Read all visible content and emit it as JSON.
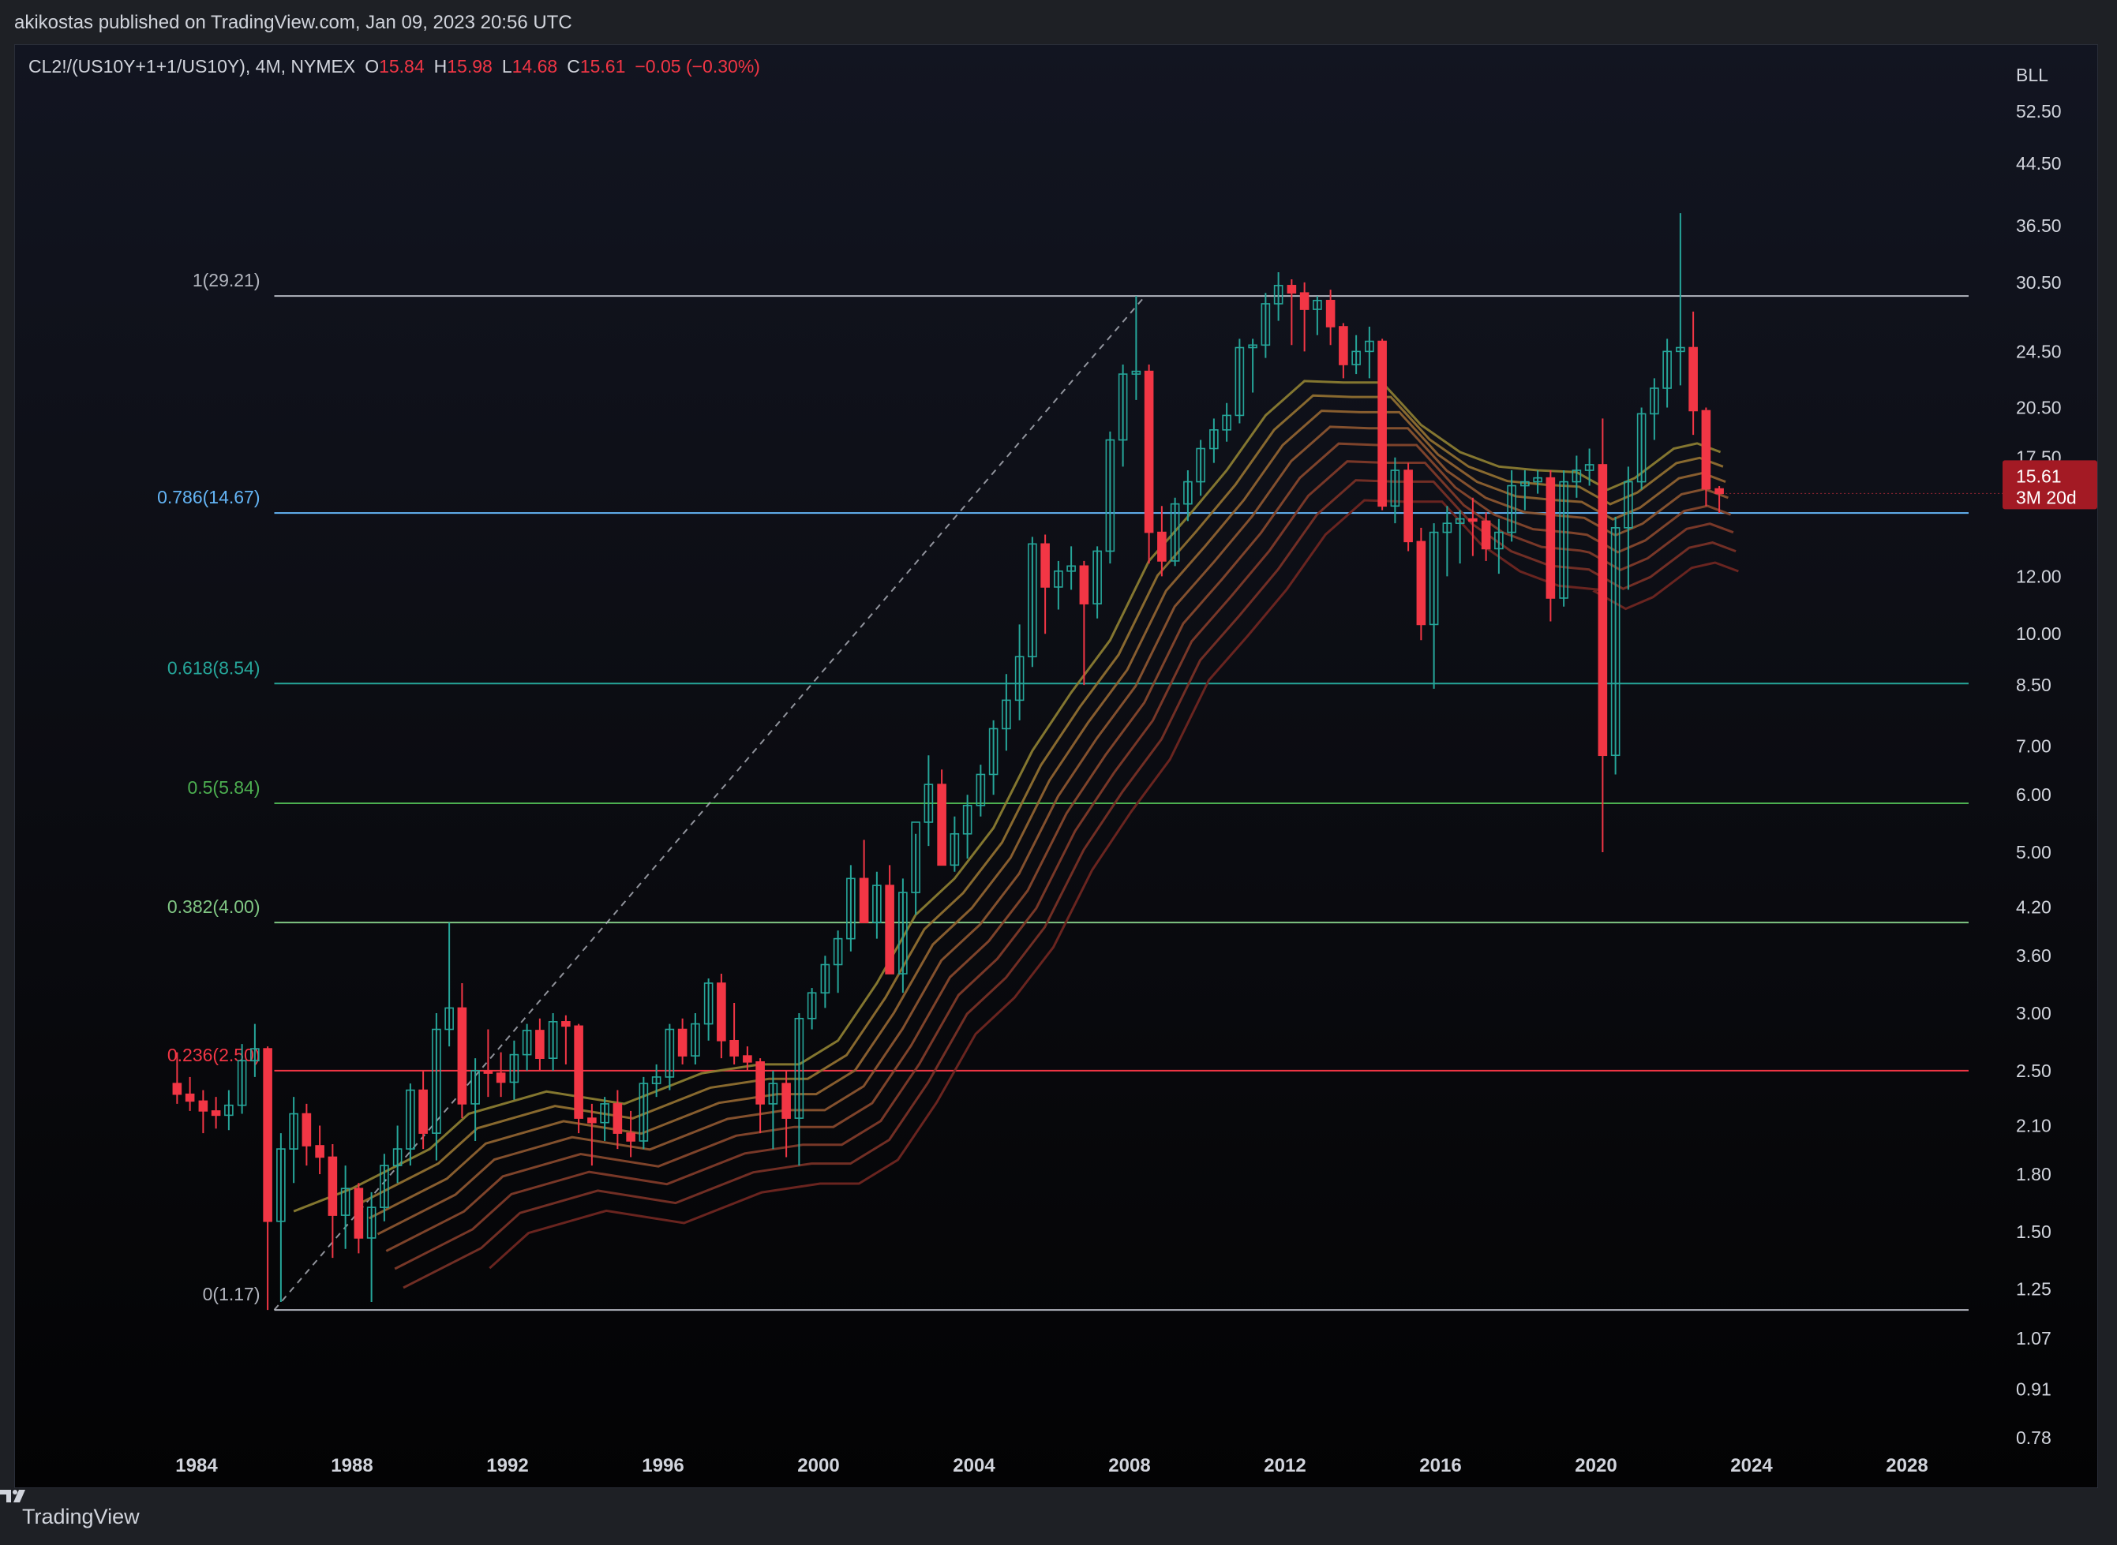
{
  "header": {
    "published": "akikostas published on TradingView.com, Jan 09, 2023 20:56 UTC"
  },
  "legend": {
    "symbol": "CL2!/(US10Y+1+1/US10Y), 4M, NYMEX",
    "o_label": "O",
    "o": "15.84",
    "h_label": "H",
    "h": "15.98",
    "l_label": "L",
    "l": "14.68",
    "c_label": "C",
    "c": "15.61",
    "change": "−0.05 (−0.30%)"
  },
  "footer": {
    "brand": "TradingView"
  },
  "colors": {
    "up": "#26a69a",
    "down": "#f23645",
    "background": "#0b0c11",
    "fib_1": "#b2b5be",
    "fib_0786": "#64b5f6",
    "fib_0618": "#26a69a",
    "fib_05": "#4caf50",
    "fib_0382": "#81c784",
    "fib_0236": "#f23645",
    "fib_0": "#b2b5be"
  },
  "chart_data": {
    "type": "candlestick",
    "scale": "log",
    "y_axis_label": "BLL",
    "y_ticks": [
      52.5,
      44.5,
      36.5,
      30.5,
      24.5,
      20.5,
      17.5,
      12.0,
      10.0,
      8.5,
      7.0,
      6.0,
      5.0,
      4.2,
      3.6,
      3.0,
      2.5,
      2.1,
      1.8,
      1.5,
      1.25,
      1.07,
      0.91,
      0.78
    ],
    "y_tick_labels": [
      "52.50",
      "44.50",
      "36.50",
      "30.50",
      "24.50",
      "20.50",
      "17.50",
      "12.00",
      "10.00",
      "8.50",
      "7.00",
      "6.00",
      "5.00",
      "4.20",
      "3.60",
      "3.00",
      "2.50",
      "2.10",
      "1.80",
      "1.50",
      "1.25",
      "1.07",
      "0.91",
      "0.78"
    ],
    "x_ticks": [
      "1984",
      "1988",
      "1992",
      "1996",
      "2000",
      "2004",
      "2008",
      "2012",
      "2016",
      "2020",
      "2024",
      "2028"
    ],
    "last_price": {
      "value": "15.61",
      "countdown": "3M 20d"
    },
    "fib_levels": [
      {
        "label": "1(29.21)",
        "value": 29.21,
        "color": "#b2b5be"
      },
      {
        "label": "0.786(14.67)",
        "value": 14.67,
        "color": "#64b5f6"
      },
      {
        "label": "0.618(8.54)",
        "value": 8.54,
        "color": "#26a69a"
      },
      {
        "label": "0.5(5.84)",
        "value": 5.84,
        "color": "#4caf50"
      },
      {
        "label": "0.382(4.00)",
        "value": 4.0,
        "color": "#81c784"
      },
      {
        "label": "0.236(2.50)",
        "value": 2.5,
        "color": "#f23645"
      },
      {
        "label": "0(1.17)",
        "value": 1.17,
        "color": "#b2b5be"
      }
    ],
    "fib_anchor": {
      "start": {
        "t": 1986.0,
        "v": 1.17
      },
      "end": {
        "t": 2008.4,
        "v": 29.21
      }
    },
    "candles": [
      {
        "t": 1983.5,
        "o": 2.4,
        "h": 2.65,
        "l": 2.25,
        "c": 2.32
      },
      {
        "t": 1983.83,
        "o": 2.32,
        "h": 2.45,
        "l": 2.2,
        "c": 2.27
      },
      {
        "t": 1984.17,
        "o": 2.27,
        "h": 2.35,
        "l": 2.05,
        "c": 2.2
      },
      {
        "t": 1984.5,
        "o": 2.2,
        "h": 2.3,
        "l": 2.08,
        "c": 2.17
      },
      {
        "t": 1984.83,
        "o": 2.17,
        "h": 2.35,
        "l": 2.07,
        "c": 2.24
      },
      {
        "t": 1985.17,
        "o": 2.24,
        "h": 2.72,
        "l": 2.18,
        "c": 2.58
      },
      {
        "t": 1985.5,
        "o": 2.58,
        "h": 2.9,
        "l": 2.45,
        "c": 2.68
      },
      {
        "t": 1985.83,
        "o": 2.68,
        "h": 2.7,
        "l": 1.17,
        "c": 1.55
      },
      {
        "t": 1986.17,
        "o": 1.55,
        "h": 2.05,
        "l": 1.2,
        "c": 1.95
      },
      {
        "t": 1986.5,
        "o": 1.95,
        "h": 2.3,
        "l": 1.75,
        "c": 2.18
      },
      {
        "t": 1986.83,
        "o": 2.18,
        "h": 2.25,
        "l": 1.85,
        "c": 1.97
      },
      {
        "t": 1987.17,
        "o": 1.97,
        "h": 2.1,
        "l": 1.8,
        "c": 1.9
      },
      {
        "t": 1987.5,
        "o": 1.9,
        "h": 1.98,
        "l": 1.38,
        "c": 1.58
      },
      {
        "t": 1987.83,
        "o": 1.58,
        "h": 1.85,
        "l": 1.42,
        "c": 1.72
      },
      {
        "t": 1988.17,
        "o": 1.72,
        "h": 1.75,
        "l": 1.4,
        "c": 1.47
      },
      {
        "t": 1988.5,
        "o": 1.47,
        "h": 1.7,
        "l": 1.2,
        "c": 1.62
      },
      {
        "t": 1988.83,
        "o": 1.62,
        "h": 1.92,
        "l": 1.55,
        "c": 1.85
      },
      {
        "t": 1989.17,
        "o": 1.85,
        "h": 2.1,
        "l": 1.75,
        "c": 1.95
      },
      {
        "t": 1989.5,
        "o": 1.95,
        "h": 2.4,
        "l": 1.85,
        "c": 2.35
      },
      {
        "t": 1989.83,
        "o": 2.35,
        "h": 2.5,
        "l": 1.95,
        "c": 2.05
      },
      {
        "t": 1990.17,
        "o": 2.05,
        "h": 3.0,
        "l": 1.88,
        "c": 2.85
      },
      {
        "t": 1990.5,
        "o": 2.85,
        "h": 4.0,
        "l": 2.7,
        "c": 3.05
      },
      {
        "t": 1990.83,
        "o": 3.05,
        "h": 3.3,
        "l": 2.15,
        "c": 2.25
      },
      {
        "t": 1991.17,
        "o": 2.25,
        "h": 2.6,
        "l": 2.0,
        "c": 2.5
      },
      {
        "t": 1991.5,
        "o": 2.5,
        "h": 2.85,
        "l": 2.3,
        "c": 2.48
      },
      {
        "t": 1991.83,
        "o": 2.48,
        "h": 2.65,
        "l": 2.3,
        "c": 2.41
      },
      {
        "t": 1992.17,
        "o": 2.41,
        "h": 2.75,
        "l": 2.28,
        "c": 2.63
      },
      {
        "t": 1992.5,
        "o": 2.63,
        "h": 2.9,
        "l": 2.5,
        "c": 2.84
      },
      {
        "t": 1992.83,
        "o": 2.84,
        "h": 2.95,
        "l": 2.5,
        "c": 2.6
      },
      {
        "t": 1993.17,
        "o": 2.6,
        "h": 3.0,
        "l": 2.5,
        "c": 2.92
      },
      {
        "t": 1993.5,
        "o": 2.92,
        "h": 2.98,
        "l": 2.55,
        "c": 2.88
      },
      {
        "t": 1993.83,
        "o": 2.88,
        "h": 2.9,
        "l": 2.05,
        "c": 2.15
      },
      {
        "t": 1994.17,
        "o": 2.15,
        "h": 2.25,
        "l": 1.85,
        "c": 2.12
      },
      {
        "t": 1994.5,
        "o": 2.12,
        "h": 2.3,
        "l": 2.0,
        "c": 2.25
      },
      {
        "t": 1994.83,
        "o": 2.25,
        "h": 2.35,
        "l": 1.95,
        "c": 2.05
      },
      {
        "t": 1995.17,
        "o": 2.05,
        "h": 2.2,
        "l": 1.9,
        "c": 2.0
      },
      {
        "t": 1995.5,
        "o": 2.0,
        "h": 2.45,
        "l": 1.95,
        "c": 2.4
      },
      {
        "t": 1995.83,
        "o": 2.4,
        "h": 2.55,
        "l": 2.3,
        "c": 2.45
      },
      {
        "t": 1996.17,
        "o": 2.45,
        "h": 2.9,
        "l": 2.35,
        "c": 2.85
      },
      {
        "t": 1996.5,
        "o": 2.85,
        "h": 2.95,
        "l": 2.55,
        "c": 2.62
      },
      {
        "t": 1996.83,
        "o": 2.62,
        "h": 3.0,
        "l": 2.55,
        "c": 2.9
      },
      {
        "t": 1997.17,
        "o": 2.9,
        "h": 3.35,
        "l": 2.75,
        "c": 3.3
      },
      {
        "t": 1997.5,
        "o": 3.3,
        "h": 3.4,
        "l": 2.6,
        "c": 2.75
      },
      {
        "t": 1997.83,
        "o": 2.75,
        "h": 3.1,
        "l": 2.55,
        "c": 2.62
      },
      {
        "t": 1998.17,
        "o": 2.62,
        "h": 2.7,
        "l": 2.5,
        "c": 2.57
      },
      {
        "t": 1998.5,
        "o": 2.57,
        "h": 2.6,
        "l": 2.05,
        "c": 2.25
      },
      {
        "t": 1998.83,
        "o": 2.25,
        "h": 2.5,
        "l": 1.95,
        "c": 2.4
      },
      {
        "t": 1999.17,
        "o": 2.4,
        "h": 2.5,
        "l": 1.9,
        "c": 2.15
      },
      {
        "t": 1999.5,
        "o": 2.15,
        "h": 3.0,
        "l": 1.85,
        "c": 2.95
      },
      {
        "t": 1999.83,
        "o": 2.95,
        "h": 3.25,
        "l": 2.85,
        "c": 3.2
      },
      {
        "t": 2000.17,
        "o": 3.2,
        "h": 3.6,
        "l": 3.05,
        "c": 3.5
      },
      {
        "t": 2000.5,
        "o": 3.5,
        "h": 3.9,
        "l": 3.2,
        "c": 3.8
      },
      {
        "t": 2000.83,
        "o": 3.8,
        "h": 4.8,
        "l": 3.65,
        "c": 4.6
      },
      {
        "t": 2001.17,
        "o": 4.6,
        "h": 5.2,
        "l": 4.3,
        "c": 4.0
      },
      {
        "t": 2001.5,
        "o": 4.0,
        "h": 4.7,
        "l": 3.8,
        "c": 4.5
      },
      {
        "t": 2001.83,
        "o": 4.5,
        "h": 4.8,
        "l": 3.4,
        "c": 3.4
      },
      {
        "t": 2002.17,
        "o": 3.4,
        "h": 4.6,
        "l": 3.2,
        "c": 4.4
      },
      {
        "t": 2002.5,
        "o": 4.4,
        "h": 5.3,
        "l": 4.1,
        "c": 5.5
      },
      {
        "t": 2002.83,
        "o": 5.5,
        "h": 6.8,
        "l": 5.1,
        "c": 6.2
      },
      {
        "t": 2003.17,
        "o": 6.2,
        "h": 6.5,
        "l": 4.8,
        "c": 4.8
      },
      {
        "t": 2003.5,
        "o": 4.8,
        "h": 5.6,
        "l": 4.7,
        "c": 5.3
      },
      {
        "t": 2003.83,
        "o": 5.3,
        "h": 6.0,
        "l": 4.9,
        "c": 5.8
      },
      {
        "t": 2004.17,
        "o": 5.8,
        "h": 6.6,
        "l": 5.6,
        "c": 6.4
      },
      {
        "t": 2004.5,
        "o": 6.4,
        "h": 7.6,
        "l": 6.0,
        "c": 7.4
      },
      {
        "t": 2004.83,
        "o": 7.4,
        "h": 8.8,
        "l": 6.9,
        "c": 8.1
      },
      {
        "t": 2005.17,
        "o": 8.1,
        "h": 10.3,
        "l": 7.6,
        "c": 9.3
      },
      {
        "t": 2005.5,
        "o": 9.3,
        "h": 13.6,
        "l": 9.0,
        "c": 13.3
      },
      {
        "t": 2005.83,
        "o": 13.3,
        "h": 13.7,
        "l": 10.0,
        "c": 11.6
      },
      {
        "t": 2006.17,
        "o": 11.6,
        "h": 12.6,
        "l": 10.8,
        "c": 12.2
      },
      {
        "t": 2006.5,
        "o": 12.2,
        "h": 13.2,
        "l": 11.5,
        "c": 12.4
      },
      {
        "t": 2006.83,
        "o": 12.4,
        "h": 12.6,
        "l": 8.5,
        "c": 11.0
      },
      {
        "t": 2007.17,
        "o": 11.0,
        "h": 13.2,
        "l": 10.5,
        "c": 13.0
      },
      {
        "t": 2007.5,
        "o": 13.0,
        "h": 19.0,
        "l": 12.5,
        "c": 18.5
      },
      {
        "t": 2007.83,
        "o": 18.5,
        "h": 23.5,
        "l": 17.0,
        "c": 22.8
      },
      {
        "t": 2008.17,
        "o": 22.8,
        "h": 29.21,
        "l": 21.0,
        "c": 23.0
      },
      {
        "t": 2008.5,
        "o": 23.0,
        "h": 23.5,
        "l": 12.5,
        "c": 13.8
      },
      {
        "t": 2008.83,
        "o": 13.8,
        "h": 15.0,
        "l": 12.0,
        "c": 12.6
      },
      {
        "t": 2009.17,
        "o": 12.6,
        "h": 15.4,
        "l": 12.4,
        "c": 15.1
      },
      {
        "t": 2009.5,
        "o": 15.1,
        "h": 16.8,
        "l": 14.3,
        "c": 16.2
      },
      {
        "t": 2009.83,
        "o": 16.2,
        "h": 18.5,
        "l": 15.5,
        "c": 18.0
      },
      {
        "t": 2010.17,
        "o": 18.0,
        "h": 19.8,
        "l": 17.2,
        "c": 19.1
      },
      {
        "t": 2010.5,
        "o": 19.1,
        "h": 20.8,
        "l": 18.4,
        "c": 20.0
      },
      {
        "t": 2010.83,
        "o": 20.0,
        "h": 25.5,
        "l": 19.5,
        "c": 24.8
      },
      {
        "t": 2011.17,
        "o": 24.8,
        "h": 25.5,
        "l": 21.5,
        "c": 25.0
      },
      {
        "t": 2011.5,
        "o": 25.0,
        "h": 29.5,
        "l": 24.0,
        "c": 28.5
      },
      {
        "t": 2011.83,
        "o": 28.5,
        "h": 31.5,
        "l": 27.0,
        "c": 30.2
      },
      {
        "t": 2012.17,
        "o": 30.2,
        "h": 30.8,
        "l": 25.0,
        "c": 29.5
      },
      {
        "t": 2012.5,
        "o": 29.5,
        "h": 30.5,
        "l": 24.5,
        "c": 28.0
      },
      {
        "t": 2012.83,
        "o": 28.0,
        "h": 29.2,
        "l": 25.8,
        "c": 28.8
      },
      {
        "t": 2013.17,
        "o": 28.8,
        "h": 29.8,
        "l": 25.0,
        "c": 26.5
      },
      {
        "t": 2013.5,
        "o": 26.5,
        "h": 26.8,
        "l": 22.5,
        "c": 23.5
      },
      {
        "t": 2013.83,
        "o": 23.5,
        "h": 25.8,
        "l": 22.8,
        "c": 24.5
      },
      {
        "t": 2014.17,
        "o": 24.5,
        "h": 26.5,
        "l": 22.5,
        "c": 25.3
      },
      {
        "t": 2014.5,
        "o": 25.3,
        "h": 25.5,
        "l": 14.8,
        "c": 15.0
      },
      {
        "t": 2014.83,
        "o": 15.0,
        "h": 17.5,
        "l": 14.2,
        "c": 16.8
      },
      {
        "t": 2015.17,
        "o": 16.8,
        "h": 17.2,
        "l": 13.0,
        "c": 13.4
      },
      {
        "t": 2015.5,
        "o": 13.4,
        "h": 14.0,
        "l": 9.8,
        "c": 10.3
      },
      {
        "t": 2015.83,
        "o": 10.3,
        "h": 14.2,
        "l": 8.4,
        "c": 13.8
      },
      {
        "t": 2016.17,
        "o": 13.8,
        "h": 15.0,
        "l": 12.0,
        "c": 14.2
      },
      {
        "t": 2016.5,
        "o": 14.2,
        "h": 14.8,
        "l": 12.5,
        "c": 14.4
      },
      {
        "t": 2016.83,
        "o": 14.4,
        "h": 15.4,
        "l": 12.8,
        "c": 14.3
      },
      {
        "t": 2017.17,
        "o": 14.3,
        "h": 14.7,
        "l": 12.6,
        "c": 13.1
      },
      {
        "t": 2017.5,
        "o": 13.1,
        "h": 14.4,
        "l": 12.1,
        "c": 13.8
      },
      {
        "t": 2017.83,
        "o": 13.8,
        "h": 16.8,
        "l": 13.4,
        "c": 16.0
      },
      {
        "t": 2018.17,
        "o": 16.0,
        "h": 16.8,
        "l": 14.8,
        "c": 16.2
      },
      {
        "t": 2018.5,
        "o": 16.2,
        "h": 16.8,
        "l": 15.6,
        "c": 16.4
      },
      {
        "t": 2018.83,
        "o": 16.4,
        "h": 16.8,
        "l": 10.4,
        "c": 11.2
      },
      {
        "t": 2019.17,
        "o": 11.2,
        "h": 16.8,
        "l": 10.9,
        "c": 16.2
      },
      {
        "t": 2019.5,
        "o": 16.2,
        "h": 17.6,
        "l": 15.4,
        "c": 16.8
      },
      {
        "t": 2019.83,
        "o": 16.8,
        "h": 18.0,
        "l": 16.0,
        "c": 17.1
      },
      {
        "t": 2020.17,
        "o": 17.1,
        "h": 19.8,
        "l": 5.0,
        "c": 6.8
      },
      {
        "t": 2020.5,
        "o": 6.8,
        "h": 14.5,
        "l": 6.4,
        "c": 14.0
      },
      {
        "t": 2020.83,
        "o": 14.0,
        "h": 17.0,
        "l": 11.5,
        "c": 16.2
      },
      {
        "t": 2021.17,
        "o": 16.2,
        "h": 20.5,
        "l": 15.8,
        "c": 20.1
      },
      {
        "t": 2021.5,
        "o": 20.1,
        "h": 22.5,
        "l": 18.5,
        "c": 21.8
      },
      {
        "t": 2021.83,
        "o": 21.8,
        "h": 25.5,
        "l": 20.5,
        "c": 24.5
      },
      {
        "t": 2022.17,
        "o": 24.5,
        "h": 38.0,
        "l": 22.0,
        "c": 24.8
      },
      {
        "t": 2022.5,
        "o": 24.8,
        "h": 27.8,
        "l": 18.8,
        "c": 20.3
      },
      {
        "t": 2022.83,
        "o": 20.3,
        "h": 20.5,
        "l": 15.0,
        "c": 15.84
      },
      {
        "t": 2023.17,
        "o": 15.84,
        "h": 15.98,
        "l": 14.68,
        "c": 15.61
      }
    ],
    "ribbon": {
      "colors": [
        "#8a7c31",
        "#8f6f30",
        "#8e6230",
        "#8a542f",
        "#85472c",
        "#7e3a29",
        "#773026",
        "#6f2621"
      ],
      "base": [
        {
          "t": 1986.5,
          "v": 1.6
        },
        {
          "t": 1988.0,
          "v": 1.72
        },
        {
          "t": 1990.0,
          "v": 1.95
        },
        {
          "t": 1991.0,
          "v": 2.18
        },
        {
          "t": 1993.0,
          "v": 2.34
        },
        {
          "t": 1995.0,
          "v": 2.25
        },
        {
          "t": 1997.0,
          "v": 2.48
        },
        {
          "t": 1998.5,
          "v": 2.55
        },
        {
          "t": 1999.5,
          "v": 2.55
        },
        {
          "t": 2000.5,
          "v": 2.75
        },
        {
          "t": 2001.5,
          "v": 3.3
        },
        {
          "t": 2002.5,
          "v": 4.1
        },
        {
          "t": 2003.5,
          "v": 4.6
        },
        {
          "t": 2004.5,
          "v": 5.4
        },
        {
          "t": 2005.5,
          "v": 6.9
        },
        {
          "t": 2006.5,
          "v": 8.3
        },
        {
          "t": 2007.5,
          "v": 9.8
        },
        {
          "t": 2008.5,
          "v": 12.6
        },
        {
          "t": 2009.5,
          "v": 14.5
        },
        {
          "t": 2010.5,
          "v": 16.8
        },
        {
          "t": 2011.5,
          "v": 20.0
        },
        {
          "t": 2012.5,
          "v": 22.3
        },
        {
          "t": 2013.5,
          "v": 22.2
        },
        {
          "t": 2014.5,
          "v": 22.2
        },
        {
          "t": 2015.5,
          "v": 19.4
        },
        {
          "t": 2016.5,
          "v": 17.8
        },
        {
          "t": 2017.5,
          "v": 17.0
        },
        {
          "t": 2018.5,
          "v": 16.8
        },
        {
          "t": 2019.5,
          "v": 16.7
        },
        {
          "t": 2020.3,
          "v": 15.8
        },
        {
          "t": 2021.0,
          "v": 16.4
        },
        {
          "t": 2022.0,
          "v": 18.0
        },
        {
          "t": 2022.6,
          "v": 18.3
        },
        {
          "t": 2023.2,
          "v": 17.8
        }
      ]
    }
  }
}
